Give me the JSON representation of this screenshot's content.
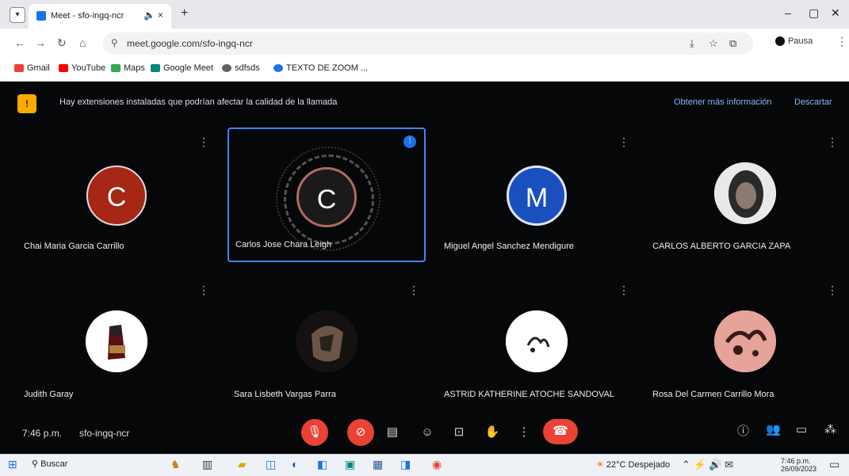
{
  "browser": {
    "tab_title": "Meet - sfo-ingq-ncr",
    "url": "meet.google.com/sfo-ingq-ncr",
    "profile_label": "Pausa"
  },
  "bookmarks": [
    {
      "label": "Gmail",
      "color": "#ea4335"
    },
    {
      "label": "YouTube",
      "color": "#ff0000"
    },
    {
      "label": "Maps",
      "color": "#34a853"
    },
    {
      "label": "Google Meet",
      "color": "#00897b"
    },
    {
      "label": "sdfsds",
      "color": "#5f6368"
    },
    {
      "label": "TEXTO DE ZOOM ...",
      "color": "#1a73e8"
    }
  ],
  "banner": {
    "text": "Hay extensiones instaladas que podrían afectar la calidad de la llamada",
    "more_label": "Obtener más información",
    "dismiss_label": "Descartar"
  },
  "participants": [
    {
      "name": "Chai Maria Garcia Carrillo",
      "initial": "C",
      "avatar_color": "#a52714",
      "speaking": false
    },
    {
      "name": "Carlos Jose Chara Leigh",
      "initial": "C",
      "avatar_color": "#1a1a1a",
      "speaking": true
    },
    {
      "name": "Miguel Angel Sanchez Mendigure",
      "initial": "M",
      "avatar_color": "#1a4fc0",
      "speaking": false
    },
    {
      "name": "CARLOS ALBERTO GARCIA ZAPA",
      "initial": "",
      "avatar_color": "#555555",
      "speaking": false
    },
    {
      "name": "Judith Garay",
      "initial": "",
      "avatar_color": "#ffffff",
      "speaking": false
    },
    {
      "name": "Sara Lisbeth Vargas Parra",
      "initial": "",
      "avatar_color": "#2a2320",
      "speaking": false
    },
    {
      "name": "ASTRID KATHERINE ATOCHE SANDOVAL",
      "initial": "",
      "avatar_color": "#ffffff",
      "speaking": false
    },
    {
      "name": "Rosa Del Carmen Carrillo Mora",
      "initial": "",
      "avatar_color": "#e6a39a",
      "speaking": false
    }
  ],
  "footer": {
    "time": "7:46 p.m.",
    "meeting_code": "sfo-ingq-ncr"
  },
  "taskbar": {
    "search_label": "Buscar",
    "weather": "22°C Despejado",
    "clock_time": "7:46 p.m.",
    "clock_date": "26/09/2023"
  },
  "colors": {
    "meet_bg": "#060709",
    "accent": "#1a73e8",
    "danger": "#ea4335"
  }
}
